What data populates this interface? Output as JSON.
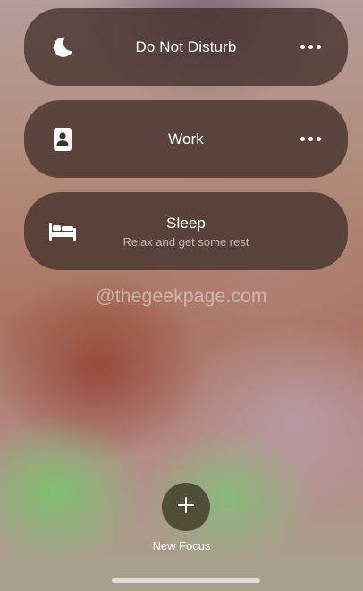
{
  "focus_modes": [
    {
      "title": "Do Not Disturb",
      "subtitle": "",
      "icon": "moon-icon",
      "has_more": true
    },
    {
      "title": "Work",
      "subtitle": "",
      "icon": "id-badge-icon",
      "has_more": true
    },
    {
      "title": "Sleep",
      "subtitle": "Relax and get some rest",
      "icon": "bed-icon",
      "has_more": false
    }
  ],
  "watermark": "@thegeekpage.com",
  "new_focus": {
    "label": "New Focus",
    "icon": "plus-icon"
  },
  "colors": {
    "card_background": "#42302A",
    "text": "#FFFFFF",
    "new_focus_button": "#3E3A26"
  }
}
